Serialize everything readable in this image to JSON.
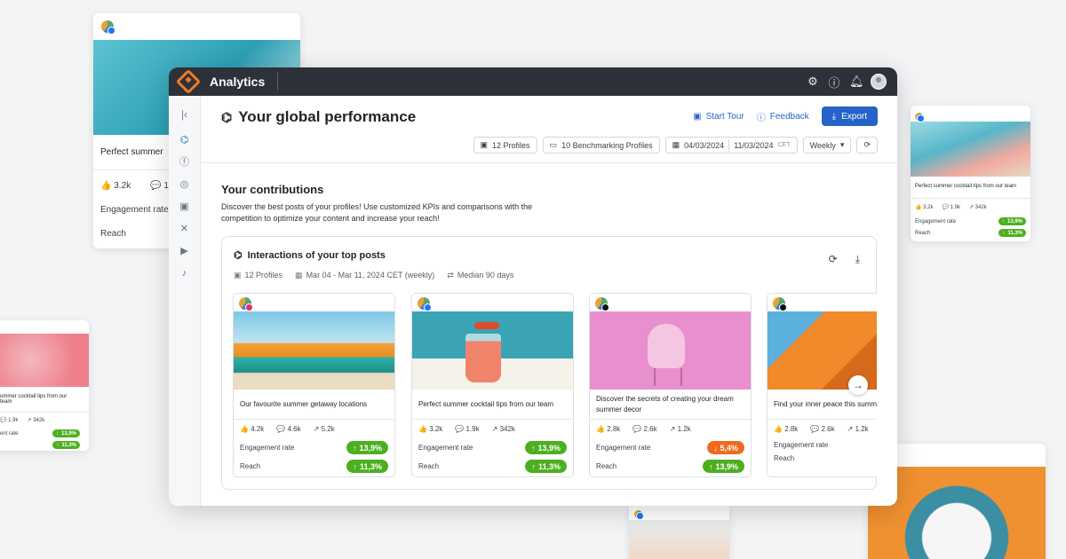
{
  "app": {
    "title": "Analytics"
  },
  "page": {
    "title": "Your global performance",
    "start_tour": "Start Tour",
    "feedback": "Feedback",
    "export": "Export"
  },
  "filters": {
    "profiles": "12 Profiles",
    "benchmarking": "10 Benchmarking Profiles",
    "date_from": "04/03/2024",
    "date_to": "11/03/2024",
    "timezone": "CET",
    "interval": "Weekly"
  },
  "contributions": {
    "title": "Your contributions",
    "description": "Discover the best posts of your profiles! Use customized KPIs and comparisons with the competition to optimize your content and increase your reach!"
  },
  "panel": {
    "title": "Interactions of your top posts",
    "profiles": "12 Profiles",
    "range": "Mar 04 - Mar 11, 2024 CET (weekly)",
    "median": "Median 90 days"
  },
  "labels": {
    "engagement_rate": "Engagement rate",
    "reach": "Reach"
  },
  "posts": [
    {
      "caption": "Our favourite summer getaway locations",
      "likes": "4.2k",
      "comments": "4.6k",
      "shares": "5.2k",
      "engagement": "13,9%",
      "engagement_dir": "up",
      "reach": "11,3%",
      "reach_dir": "up"
    },
    {
      "caption": "Perfect summer cocktail tips from our team",
      "likes": "3.2k",
      "comments": "1.9k",
      "shares": "342k",
      "engagement": "13,9%",
      "engagement_dir": "up",
      "reach": "11,3%",
      "reach_dir": "up"
    },
    {
      "caption": "Discover the secrets of creating your dream summer decor",
      "likes": "2.8k",
      "comments": "2.6k",
      "shares": "1.2k",
      "engagement": "5,4%",
      "engagement_dir": "down",
      "reach": "13,9%",
      "reach_dir": "up"
    },
    {
      "caption": "Find your inner peace this summ",
      "likes": "2.8k",
      "comments": "2.6k",
      "shares": "1.2k"
    }
  ],
  "bg_cards": {
    "left_top": {
      "caption": "Perfect summer",
      "likes": "3.2k",
      "comments": "1.9",
      "engagement": "Engagement rate",
      "reach": "Reach"
    },
    "right_top": {
      "caption": "Perfect summer cocktail tips from our team",
      "likes": "3.2k",
      "comments": "1.9k",
      "shares": "342k",
      "engagement": "Engagement rate",
      "reach": "Reach",
      "engagement_value": "13,9%",
      "reach_value": "11,3%"
    },
    "left_mid": {
      "caption": "ummer cocktail tips from our team",
      "comments": "1.9k",
      "shares": "342k",
      "engagement": "ent rate",
      "engagement_value": "13,9%",
      "reach_value": "11,3%"
    }
  },
  "colors": {
    "accent": "#2563c9",
    "topbar": "#2d3139",
    "positive": "#4caf20",
    "negative": "#ef6a1f",
    "brand": "#f07a22"
  }
}
